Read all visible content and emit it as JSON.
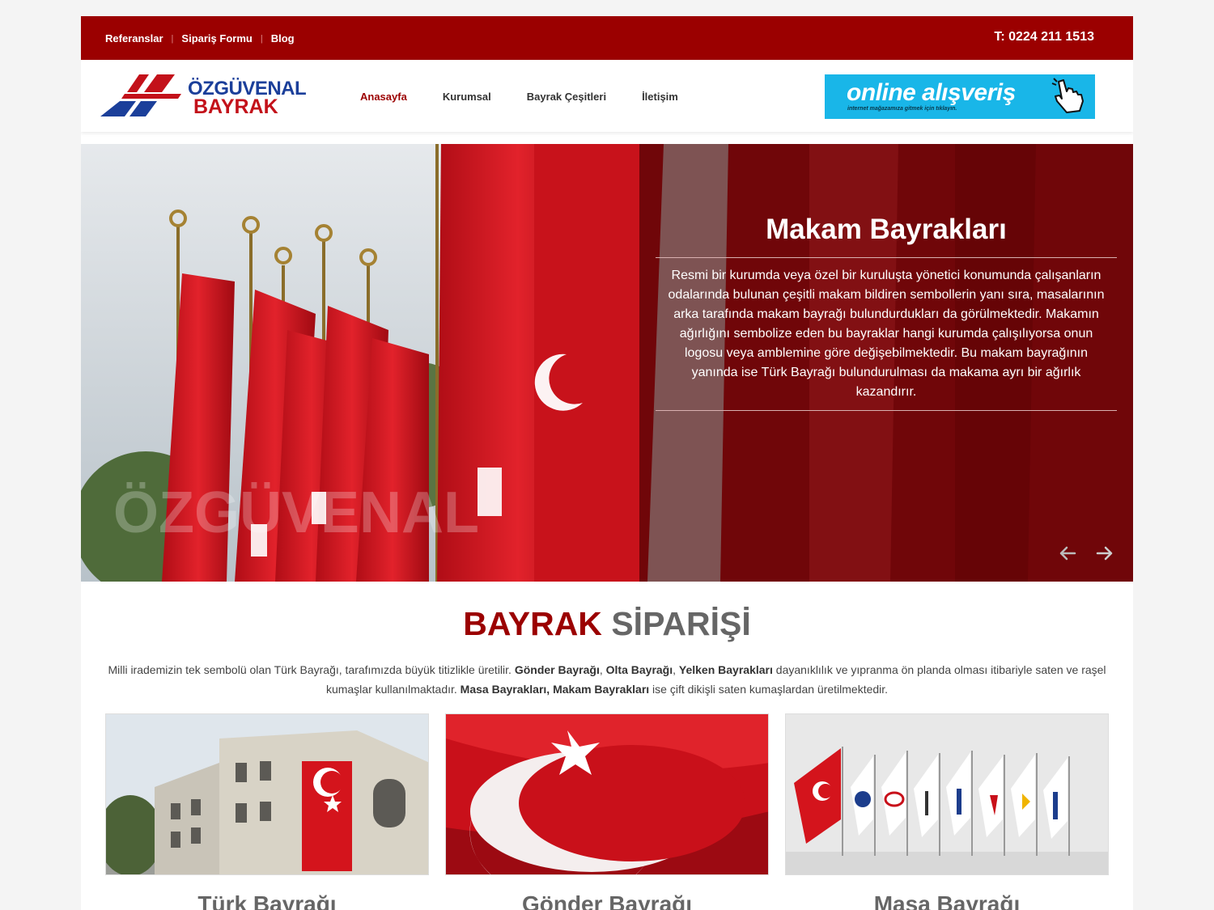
{
  "topbar": {
    "links": [
      "Referanslar",
      "Sipariş Formu",
      "Blog"
    ],
    "phone": "T: 0224 211 1513"
  },
  "header": {
    "logo_line1": "ÖZGÜVENAL",
    "logo_line2": "BAYRAK",
    "nav": [
      "Anasayfa",
      "Kurumsal",
      "Bayrak Çeşitleri",
      "İletişim"
    ],
    "active_nav": "Anasayfa",
    "shop_title": "online alışveriş",
    "shop_sub": "internet mağazamıza gitmek için tıklayın."
  },
  "slider": {
    "watermark": "ÖZGÜVENAL",
    "title": "Makam Bayrakları",
    "text": "Resmi bir kurumda veya özel bir kuruluşta yönetici konumunda çalışanların odalarında bulunan çeşitli makam bildiren sembollerin yanı sıra, masalarının arka tarafında makam bayrağı bulundurdukları da görülmektedir. Makamın ağırlığını sembolize eden bu bayraklar hangi kurumda çalışılıyorsa onun logosu veya amblemine göre değişebilmektedir. Bu makam bayrağının yanında ise Türk Bayrağı bulundurulması da makama ayrı bir ağırlık kazandırır.",
    "prev_icon": "arrow-left-icon",
    "next_icon": "arrow-right-icon"
  },
  "section": {
    "title_part1": "BAYRAK",
    "title_part2": "SİPARİŞİ",
    "desc_1": "Milli irademizin tek sembolü olan Türk Bayrağı, tarafımızda büyük titizlikle üretilir. ",
    "desc_b1": "Gönder Bayrağı",
    "desc_2": ", ",
    "desc_b2": "Olta Bayrağı",
    "desc_3": ", ",
    "desc_b3": "Yelken Bayrakları",
    "desc_4": " dayanıklılık ve yıpranma ön planda olması itibariyle saten ve raşel kumaşlar kullanılmaktadır. ",
    "desc_b4": "Masa Bayrakları, Makam Bayrakları",
    "desc_5": " ise çift dikişli saten kumaşlardan üretilmektedir."
  },
  "cards": [
    {
      "title": "Türk Bayrağı"
    },
    {
      "title": "Gönder Bayrağı"
    },
    {
      "title": "Masa Bayrağı"
    }
  ],
  "colors": {
    "brand_red": "#9b0000",
    "shop_blue": "#19b6e8",
    "logo_blue": "#1b3f9a",
    "flag_red": "#d4141c"
  }
}
